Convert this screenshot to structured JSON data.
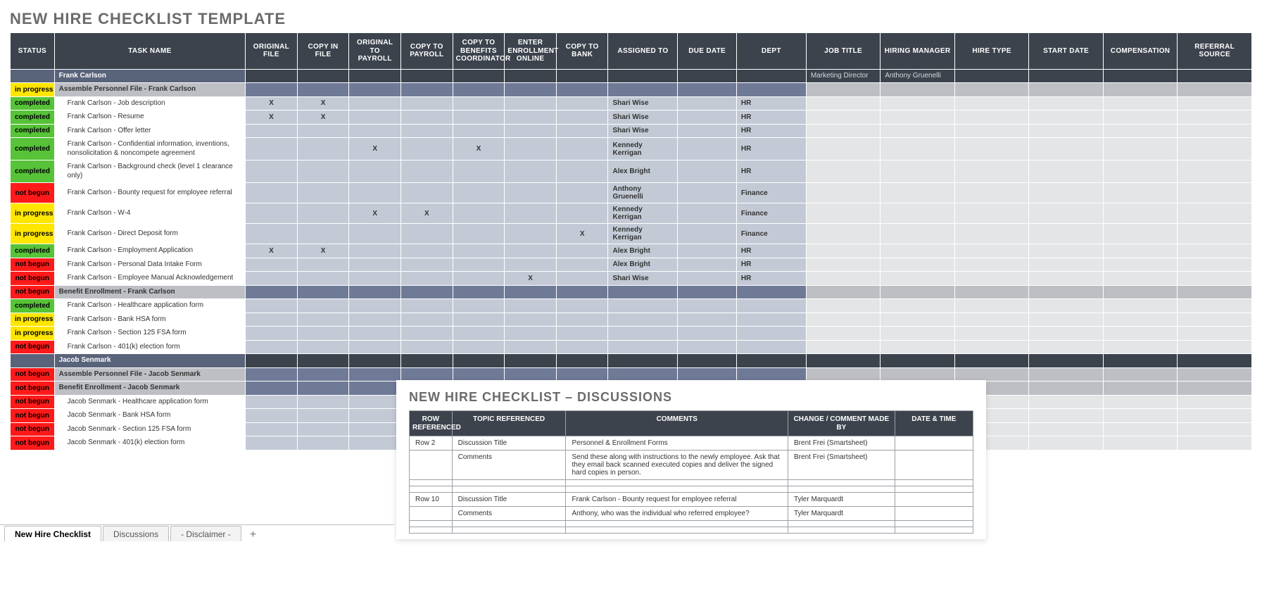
{
  "title": "NEW HIRE CHECKLIST TEMPLATE",
  "columns": [
    "STATUS",
    "TASK NAME",
    "ORIGINAL FILE",
    "COPY IN FILE",
    "ORIGINAL TO PAYROLL",
    "COPY TO PAYROLL",
    "COPY TO BENEFITS COORDINATOR",
    "ENTER ENROLLMENT ONLINE",
    "COPY TO BANK",
    "ASSIGNED TO",
    "DUE DATE",
    "DEPT",
    "JOB TITLE",
    "HIRING MANAGER",
    "HIRE TYPE",
    "START DATE",
    "COMPENSATION",
    "REFERRAL SOURCE"
  ],
  "rows": [
    {
      "kind": "person",
      "task": "Frank Carlson",
      "jobTitle": "Marketing Director",
      "hiringManager": "Anthony Gruenelli"
    },
    {
      "kind": "section",
      "status": "in progress",
      "task": "Assemble Personnel File - Frank Carlson"
    },
    {
      "kind": "item",
      "status": "completed",
      "task": "Frank Carlson - Job description",
      "checks": {
        "originalFile": "X",
        "copyInFile": "X"
      },
      "assignedTo": "Shari Wise",
      "dept": "HR"
    },
    {
      "kind": "item",
      "status": "completed",
      "task": "Frank Carlson - Resume",
      "checks": {
        "originalFile": "X",
        "copyInFile": "X"
      },
      "assignedTo": "Shari Wise",
      "dept": "HR"
    },
    {
      "kind": "item",
      "status": "completed",
      "task": "Frank Carlson - Offer letter",
      "assignedTo": "Shari Wise",
      "dept": "HR"
    },
    {
      "kind": "item",
      "status": "completed",
      "task": "Frank Carlson - Confidential information, inventions, nonsolicitation & noncompete agreement",
      "checks": {
        "originalToPayroll": "X",
        "copyToBenefits": "X"
      },
      "assignedTo": "Kennedy Kerrigan",
      "dept": "HR"
    },
    {
      "kind": "item",
      "status": "completed",
      "task": "Frank Carlson - Background check (level 1 clearance only)",
      "assignedTo": "Alex Bright",
      "dept": "HR"
    },
    {
      "kind": "item",
      "status": "not begun",
      "task": "Frank Carlson - Bounty request for employee referral",
      "assignedTo": "Anthony Gruenelli",
      "dept": "Finance"
    },
    {
      "kind": "item",
      "status": "in progress",
      "task": "Frank Carlson - W-4",
      "checks": {
        "originalToPayroll": "X",
        "copyToPayroll": "X"
      },
      "assignedTo": "Kennedy Kerrigan",
      "dept": "Finance"
    },
    {
      "kind": "item",
      "status": "in progress",
      "task": "Frank Carlson - Direct Deposit form",
      "checks": {
        "copyToBank": "X"
      },
      "assignedTo": "Kennedy Kerrigan",
      "dept": "Finance"
    },
    {
      "kind": "item",
      "status": "completed",
      "task": "Frank Carlson - Employment Application",
      "checks": {
        "originalFile": "X",
        "copyInFile": "X"
      },
      "assignedTo": "Alex Bright",
      "dept": "HR"
    },
    {
      "kind": "item",
      "status": "not begun",
      "task": "Frank Carlson - Personal Data Intake Form",
      "assignedTo": "Alex Bright",
      "dept": "HR"
    },
    {
      "kind": "item",
      "status": "not begun",
      "task": "Frank Carlson - Employee Manual Acknowledgement",
      "checks": {
        "enterEnrollment": "X"
      },
      "assignedTo": "Shari Wise",
      "dept": "HR"
    },
    {
      "kind": "section",
      "status": "not begun",
      "task": "Benefit Enrollment - Frank Carlson"
    },
    {
      "kind": "item",
      "status": "completed",
      "task": "Frank Carlson - Healthcare application form"
    },
    {
      "kind": "item",
      "status": "in progress",
      "task": "Frank Carlson - Bank HSA form"
    },
    {
      "kind": "item",
      "status": "in progress",
      "task": "Frank Carlson - Section 125 FSA form"
    },
    {
      "kind": "item",
      "status": "not begun",
      "task": "Frank Carlson - 401(k) election form"
    },
    {
      "kind": "person",
      "task": "Jacob Senmark"
    },
    {
      "kind": "section",
      "status": "not begun",
      "task": "Assemble Personnel File - Jacob Senmark"
    },
    {
      "kind": "section",
      "status": "not begun",
      "task": "Benefit Enrollment - Jacob Senmark"
    },
    {
      "kind": "item",
      "status": "not begun",
      "task": "Jacob Senmark - Healthcare application form"
    },
    {
      "kind": "item",
      "status": "not begun",
      "task": "Jacob Senmark - Bank HSA form"
    },
    {
      "kind": "item",
      "status": "not begun",
      "task": "Jacob Senmark - Section 125 FSA form"
    },
    {
      "kind": "item",
      "status": "not begun",
      "task": "Jacob Senmark - 401(k) election form"
    }
  ],
  "checkFields": [
    "originalFile",
    "copyInFile",
    "originalToPayroll",
    "copyToPayroll",
    "copyToBenefits",
    "enterEnrollment",
    "copyToBank"
  ],
  "discussions": {
    "title": "NEW HIRE CHECKLIST  –  DISCUSSIONS",
    "columns": [
      "ROW REFERENCED",
      "TOPIC REFERENCED",
      "COMMENTS",
      "CHANGE / COMMENT MADE BY",
      "DATE & TIME"
    ],
    "rows": [
      {
        "row": "Row 2",
        "topic": "Discussion Title",
        "comments": "Personnel & Enrollment Forms",
        "madeBy": "Brent Frei (Smartsheet)",
        "date": ""
      },
      {
        "row": "",
        "topic": "Comments",
        "comments": "Send these along with instructions to the newly employee.  Ask that they email back scanned executed copies and deliver the signed hard copies in person.",
        "madeBy": "Brent Frei (Smartsheet)",
        "date": ""
      },
      {
        "row": "",
        "topic": "",
        "comments": "",
        "madeBy": "",
        "date": ""
      },
      {
        "row": "",
        "topic": "",
        "comments": "",
        "madeBy": "",
        "date": ""
      },
      {
        "row": "Row 10",
        "topic": "Discussion Title",
        "comments": "Frank Carlson - Bounty request for employee referral",
        "madeBy": "Tyler Marquardt",
        "date": ""
      },
      {
        "row": "",
        "topic": "Comments",
        "comments": "Anthony, who was the individual who referred employee?",
        "madeBy": "Tyler Marquardt",
        "date": ""
      },
      {
        "row": "",
        "topic": "",
        "comments": "",
        "madeBy": "",
        "date": ""
      },
      {
        "row": "",
        "topic": "",
        "comments": "",
        "madeBy": "",
        "date": ""
      }
    ]
  },
  "tabs": [
    "New Hire Checklist",
    "Discussions",
    "- Disclaimer -"
  ],
  "plus_label": "+"
}
